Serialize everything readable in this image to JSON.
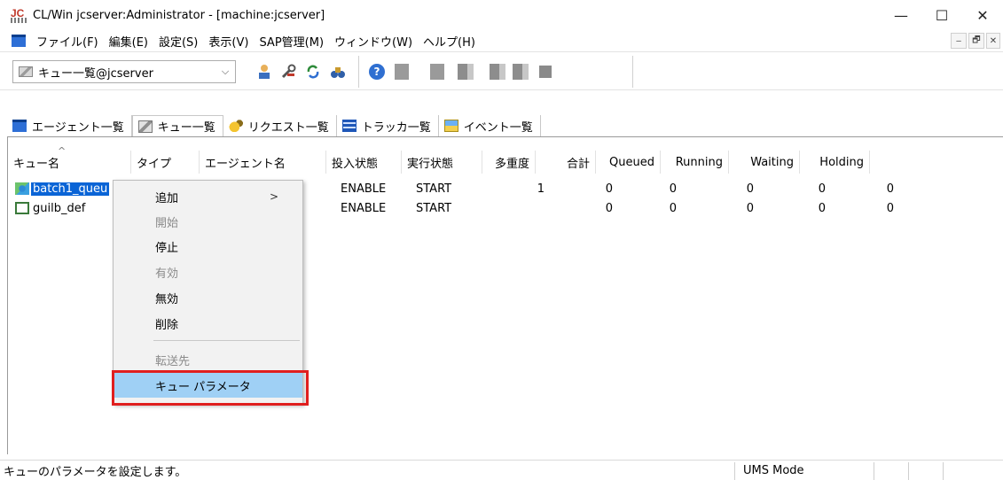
{
  "window": {
    "title": "CL/Win jcserver:Administrator - [machine:jcserver]",
    "controls": {
      "minimize": "—",
      "maximize": "☐",
      "close": "✕"
    }
  },
  "menubar": {
    "items": [
      "ファイル(F)",
      "編集(E)",
      "設定(S)",
      "表示(V)",
      "SAP管理(M)",
      "ウィンドウ(W)",
      "ヘルプ(H)"
    ],
    "mdi_controls": [
      "‒",
      "🗗",
      "✕"
    ]
  },
  "toolbar": {
    "combo_value": "キュー一覧@jcserver",
    "buttons": [
      "person-icon",
      "wrench-icon",
      "refresh-icon",
      "binoculars-icon",
      "help-icon",
      "job-icon",
      "job-icon",
      "job-icon",
      "request-icon",
      "tracker-icon",
      "stop-icon"
    ],
    "help_glyph": "?",
    "jdb_glyph": "JOB"
  },
  "tabs": [
    {
      "label": "エージェント一覧",
      "icon": "agent-icon"
    },
    {
      "label": "キュー一覧",
      "icon": "queue-icon",
      "active": true
    },
    {
      "label": "リクエスト一覧",
      "icon": "request-icon"
    },
    {
      "label": "トラッカ一覧",
      "icon": "tracker-icon"
    },
    {
      "label": "イベント一覧",
      "icon": "event-icon"
    }
  ],
  "table": {
    "sort_arrow": "^",
    "columns": [
      "キュー名",
      "タイプ",
      "エージェント名",
      "投入状態",
      "実行状態",
      "多重度",
      "合計",
      "Queued",
      "Running",
      "Waiting",
      "Holding"
    ],
    "rows": [
      {
        "name": "batch1_queu",
        "type": "",
        "agent": "",
        "submit": "ENABLE",
        "run": "START",
        "multiplicity": "1",
        "total": "0",
        "queued": "0",
        "running": "0",
        "waiting": "0",
        "holding": "0",
        "selected": true
      },
      {
        "name": "guilb_def",
        "type": "",
        "agent": "",
        "submit": "ENABLE",
        "run": "START",
        "multiplicity": "",
        "total": "0",
        "queued": "0",
        "running": "0",
        "waiting": "0",
        "holding": "0",
        "selected": false
      }
    ]
  },
  "context_menu": {
    "items": [
      {
        "label": "追加",
        "submenu_arrow": ">",
        "disabled": false
      },
      {
        "label": "開始",
        "disabled": true
      },
      {
        "label": "停止",
        "disabled": false
      },
      {
        "label": "有効",
        "disabled": true
      },
      {
        "label": "無効",
        "disabled": false
      },
      {
        "label": "削除",
        "disabled": false
      },
      {
        "label": "転送先",
        "disabled": true
      },
      {
        "label": "キュー パラメータ",
        "disabled": false,
        "highlighted": true
      }
    ]
  },
  "statusbar": {
    "message": "キューのパラメータを設定します。",
    "mode": "UMS Mode"
  },
  "colors": {
    "selection": "#0a64d6",
    "menu_highlight": "#9fd0f5",
    "annotation_box": "#e01f1f"
  }
}
